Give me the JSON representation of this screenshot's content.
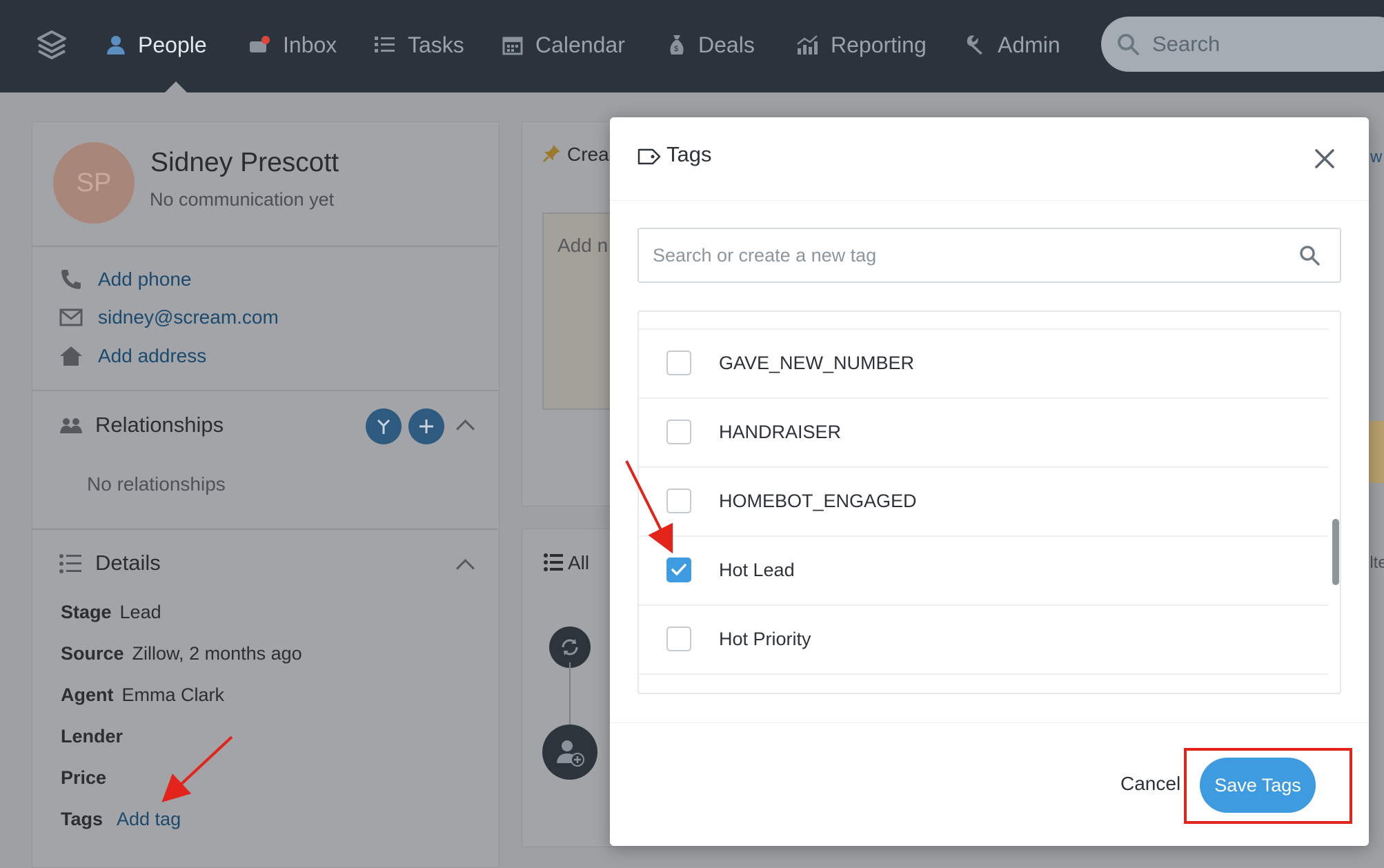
{
  "nav": {
    "items": [
      {
        "label": "People",
        "icon": "person-icon",
        "active": true
      },
      {
        "label": "Inbox",
        "icon": "inbox-icon",
        "active": false
      },
      {
        "label": "Tasks",
        "icon": "list-icon",
        "active": false
      },
      {
        "label": "Calendar",
        "icon": "calendar-icon",
        "active": false
      },
      {
        "label": "Deals",
        "icon": "money-bag-icon",
        "active": false
      },
      {
        "label": "Reporting",
        "icon": "chart-icon",
        "active": false
      },
      {
        "label": "Admin",
        "icon": "wrench-icon",
        "active": false
      }
    ],
    "search_placeholder": "Search"
  },
  "person": {
    "initials": "SP",
    "name": "Sidney Prescott",
    "subtitle": "No communication yet",
    "phone_label": "Add phone",
    "email": "sidney@scream.com",
    "address_label": "Add address"
  },
  "relationships": {
    "title": "Relationships",
    "empty": "No relationships"
  },
  "details": {
    "title": "Details",
    "stage_label": "Stage",
    "stage_value": "Lead",
    "source_label": "Source",
    "source_value": "Zillow, 2 months ago",
    "agent_label": "Agent",
    "agent_value": "Emma Clark",
    "lender_label": "Lender",
    "price_label": "Price",
    "tags_label": "Tags",
    "tags_link": "Add tag"
  },
  "middle": {
    "create_label": "Crea",
    "note_placeholder": "Add n",
    "all_label": "All",
    "peek_right_top": "w",
    "peek_right_mid": "ilte"
  },
  "modal": {
    "title": "Tags",
    "search_placeholder": "Search or create a new tag",
    "tags": [
      {
        "name": "GAVE_NEW_NUMBER",
        "checked": false
      },
      {
        "name": "HANDRAISER",
        "checked": false
      },
      {
        "name": "HOMEBOT_ENGAGED",
        "checked": false
      },
      {
        "name": "Hot Lead",
        "checked": true
      },
      {
        "name": "Hot Priority",
        "checked": false
      }
    ],
    "cancel_label": "Cancel",
    "save_label": "Save Tags"
  },
  "colors": {
    "nav_bg": "#2b343d",
    "accent": "#3e9be0",
    "annotation": "#e3241c"
  }
}
